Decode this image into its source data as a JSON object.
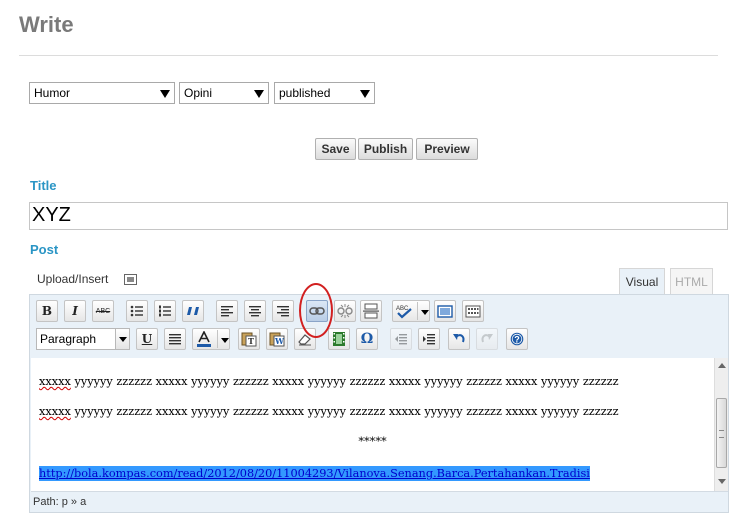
{
  "page": {
    "title": "Write"
  },
  "selects": [
    {
      "value": "Humor"
    },
    {
      "value": "Opini"
    },
    {
      "value": "published"
    }
  ],
  "actions": {
    "save": "Save",
    "publish": "Publish",
    "preview": "Preview"
  },
  "fields": {
    "title_label": "Title",
    "title_value": "XYZ",
    "post_label": "Post"
  },
  "media": {
    "upload_label": "Upload/Insert"
  },
  "editor_tabs": {
    "visual": "Visual",
    "html": "HTML"
  },
  "toolbar": {
    "format_value": "Paragraph",
    "abc": "ABC"
  },
  "content": {
    "line1_word": "xxxxx",
    "line1_rest": " yyyyyy zzzzzz xxxxx yyyyyy zzzzzz xxxxx yyyyyy zzzzzz xxxxx yyyyyy zzzzzz xxxxx yyyyyy zzzzzz",
    "line2_word": "xxxxx",
    "line2_rest": " yyyyyy zzzzzz xxxxx yyyyyy zzzzzz xxxxx yyyyyy zzzzzz xxxxx yyyyyy zzzzzz xxxxx yyyyyy zzzzzz",
    "separator": "*****",
    "link": "http://bola.kompas.com/read/2012/08/20/11004293/Vilanova.Senang.Barca.Pertahankan.Tradisi"
  },
  "status": {
    "path": "Path: p » a"
  },
  "colors": {
    "accent": "#2a95c5",
    "highlight": "#3399ff",
    "annotation": "#d22020"
  }
}
